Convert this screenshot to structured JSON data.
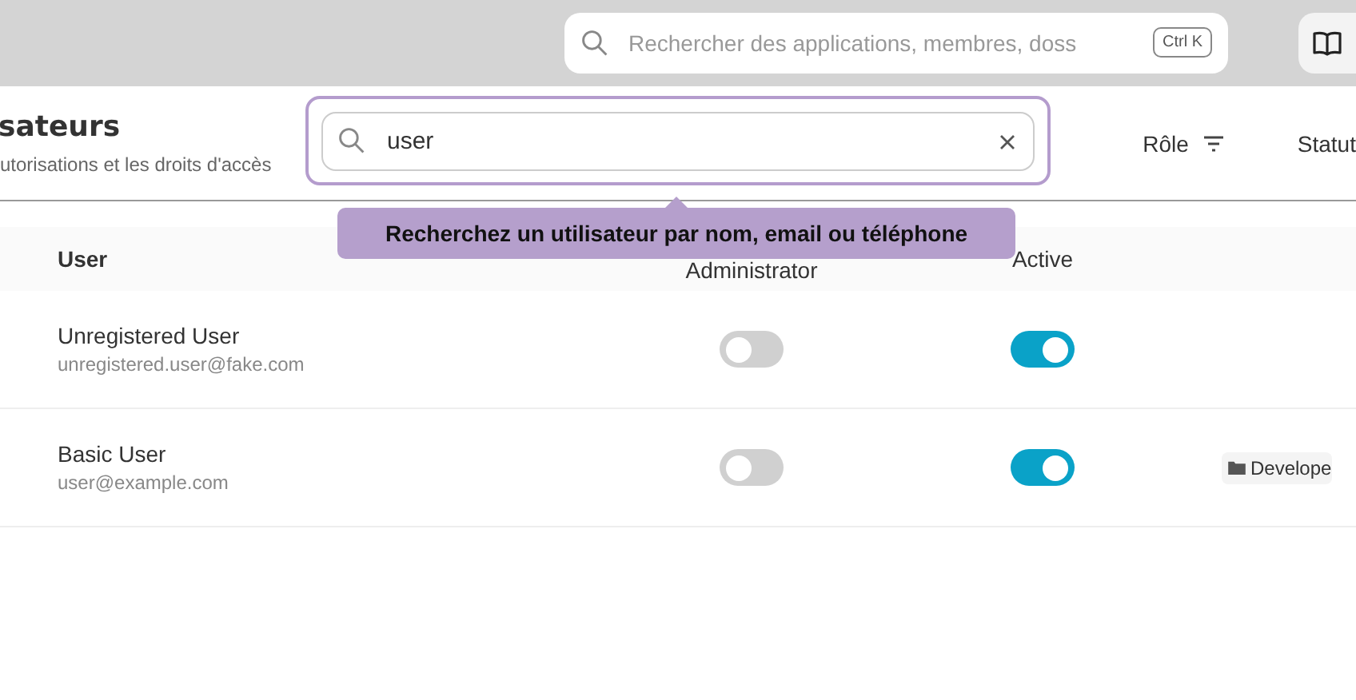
{
  "topbar": {
    "search": {
      "placeholder": "Rechercher des applications, membres, doss",
      "shortcut": "Ctrl K"
    }
  },
  "header": {
    "title": "sateurs",
    "subtitle": "utorisations et les droits d'accès",
    "search": {
      "value": "user",
      "focused": true
    },
    "tooltip": "Recherchez un utilisateur par nom, email ou téléphone",
    "filters": [
      "Rôle",
      "Statut"
    ]
  },
  "table": {
    "columns": [
      "User",
      "Administrator",
      "Active"
    ],
    "rows": [
      {
        "name": "Unregistered User",
        "email": "unregistered.user@fake.com",
        "administrator": false,
        "active": true
      },
      {
        "name": "Basic User",
        "email": "user@example.com",
        "administrator": false,
        "active": true,
        "tag": "Develope"
      }
    ]
  }
}
